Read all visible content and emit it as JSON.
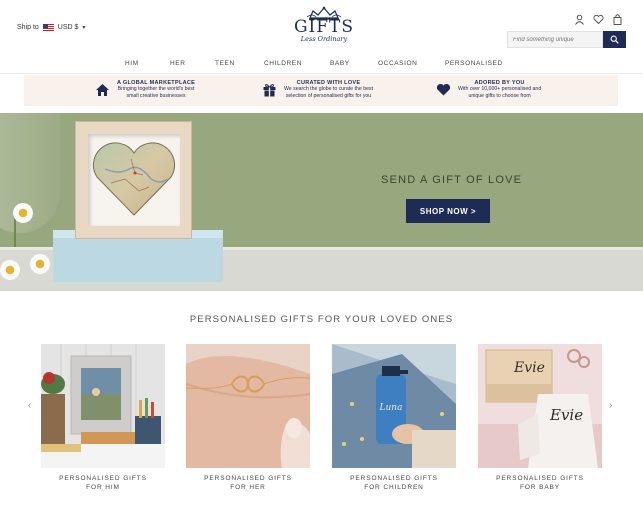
{
  "header": {
    "ship_to_label": "Ship to",
    "currency": "USD $",
    "logo_main": "GIFTS",
    "logo_sub": "Less Ordinary",
    "search_placeholder": "Find something unique"
  },
  "nav": {
    "items": [
      "HIM",
      "HER",
      "TEEN",
      "CHILDREN",
      "BABY",
      "OCCASION",
      "PERSONALISED"
    ]
  },
  "benefits": [
    {
      "icon": "house-icon",
      "title": "A GLOBAL MARKETPLACE",
      "line1": "Bringing together the world's best",
      "line2": "small creative businesses"
    },
    {
      "icon": "gift-icon",
      "title": "CURATED WITH LOVE",
      "line1": "We search the globe to curate the best",
      "line2": "selection of personalised gifts for you"
    },
    {
      "icon": "heart-icon",
      "title": "ADORED BY YOU",
      "line1": "With over 10,000+ personalised and",
      "line2": "unique gifts to choose from"
    }
  ],
  "hero": {
    "title": "SEND A GIFT OF LOVE",
    "button": "SHOP NOW >"
  },
  "section": {
    "title": "PERSONALISED GIFTS FOR YOUR LOVED ONES",
    "prev_arrow": "‹",
    "next_arrow": "›"
  },
  "cards": [
    {
      "line1": "PERSONALISED GIFTS",
      "line2": "FOR HIM"
    },
    {
      "line1": "PERSONALISED GIFTS",
      "line2": "FOR HER"
    },
    {
      "line1": "PERSONALISED GIFTS",
      "line2": "FOR CHILDREN"
    },
    {
      "line1": "PERSONALISED GIFTS",
      "line2": "FOR BABY"
    }
  ],
  "colors": {
    "brand_navy": "#1e2b55",
    "hero_green": "#97a77e",
    "benefit_bg": "#f8f1ec"
  }
}
